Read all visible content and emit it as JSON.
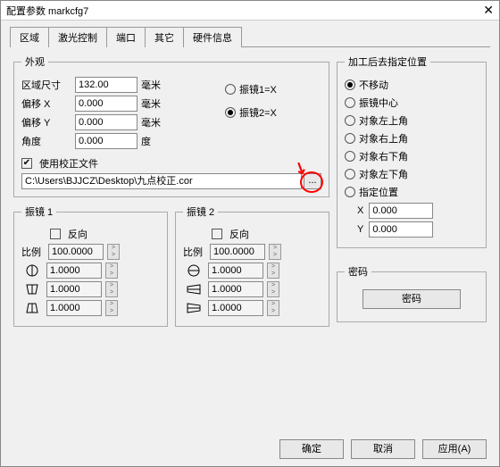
{
  "window": {
    "title": "配置参数 markcfg7"
  },
  "tabs": [
    "区域",
    "激光控制",
    "端口",
    "其它",
    "硬件信息"
  ],
  "appearance": {
    "legend": "外观",
    "area_label": "区域尺寸",
    "area_value": "132.00",
    "area_unit": "毫米",
    "offx_label": "偏移 X",
    "offx_value": "0.000",
    "offx_unit": "毫米",
    "offy_label": "偏移 Y",
    "offy_value": "0.000",
    "offy_unit": "毫米",
    "angle_label": "角度",
    "angle_value": "0.000",
    "angle_unit": "度",
    "opt1": "振镜1=X",
    "opt2": "振镜2=X",
    "use_file": "使用校正文件",
    "file_path": "C:\\Users\\BJJCZ\\Desktop\\九点校正.cor"
  },
  "galvo": {
    "g1_legend": "振镜 1",
    "g2_legend": "振镜 2",
    "reverse": "反向",
    "ratio_label": "比例",
    "ratio_value": "100.0000",
    "k1": "1.0000",
    "k2": "1.0000",
    "k3": "1.0000"
  },
  "goto": {
    "legend": "加工后去指定位置",
    "opts": [
      "不移动",
      "振镜中心",
      "对象左上角",
      "对象右上角",
      "对象右下角",
      "对象左下角",
      "指定位置"
    ],
    "x_label": "X",
    "x_value": "0.000",
    "y_label": "Y",
    "y_value": "0.000"
  },
  "pwd": {
    "legend": "密码",
    "btn": "密码"
  },
  "footer": {
    "ok": "确定",
    "cancel": "取消",
    "apply": "应用(A)"
  }
}
